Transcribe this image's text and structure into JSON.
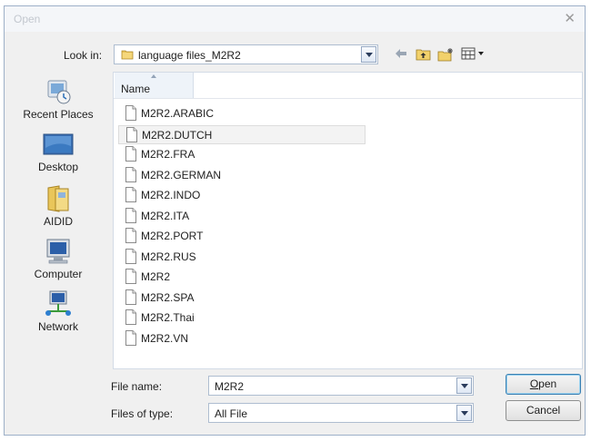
{
  "window": {
    "title": "Open"
  },
  "look_in": {
    "label": "Look in:",
    "value": "language files_M2R2"
  },
  "toolbar": {
    "back_icon": "back-arrow-icon",
    "up_icon": "up-folder-icon",
    "new_folder_icon": "new-folder-icon",
    "views_icon": "views-menu-icon"
  },
  "places": [
    {
      "label": "Recent Places",
      "icon": "recent-places-icon"
    },
    {
      "label": "Desktop",
      "icon": "desktop-icon"
    },
    {
      "label": "AIDID",
      "icon": "user-folder-icon"
    },
    {
      "label": "Computer",
      "icon": "computer-icon"
    },
    {
      "label": "Network",
      "icon": "network-icon"
    }
  ],
  "file_list": {
    "column_name": "Name",
    "files": [
      "M2R2.ARABIC",
      "M2R2.DUTCH",
      "M2R2.FRA",
      "M2R2.GERMAN",
      "M2R2.INDO",
      "M2R2.ITA",
      "M2R2.PORT",
      "M2R2.RUS",
      "M2R2",
      "M2R2.SPA",
      "M2R2.Thai",
      "M2R2.VN"
    ],
    "hovered_index": 1
  },
  "file_name": {
    "label": "File name:",
    "value": "M2R2"
  },
  "file_type": {
    "label": "Files of type:",
    "value": "All File"
  },
  "buttons": {
    "open_prefix": "O",
    "open_rest": "pen",
    "cancel": "Cancel"
  },
  "colors": {
    "accent": "#3c7fb1",
    "title_text": "#c3c8cf",
    "pane_border": "#d3dbe6"
  }
}
